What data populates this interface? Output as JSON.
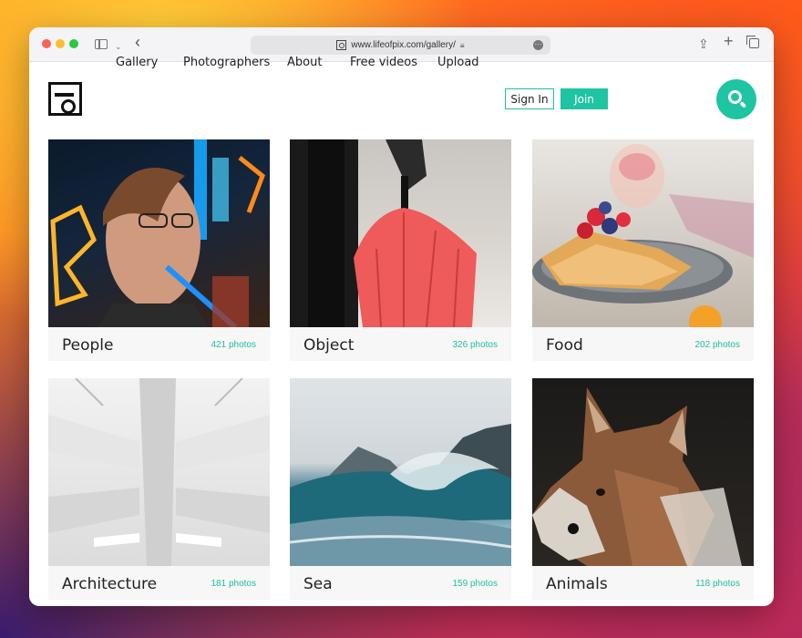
{
  "browser": {
    "url": "www.lifeofpix.com/gallery/"
  },
  "nav": {
    "gallery": "Gallery",
    "photographers": "Photographers",
    "about": "About",
    "free_videos": "Free videos",
    "upload": "Upload",
    "sign_in": "Sign In",
    "join": "Join"
  },
  "colors": {
    "accent": "#1fc4a2"
  },
  "categories": [
    {
      "name": "People",
      "count": "421 photos"
    },
    {
      "name": "Object",
      "count": "326 photos"
    },
    {
      "name": "Food",
      "count": "202 photos"
    },
    {
      "name": "Architecture",
      "count": "181 photos"
    },
    {
      "name": "Sea",
      "count": "159 photos"
    },
    {
      "name": "Animals",
      "count": "118 photos"
    }
  ]
}
